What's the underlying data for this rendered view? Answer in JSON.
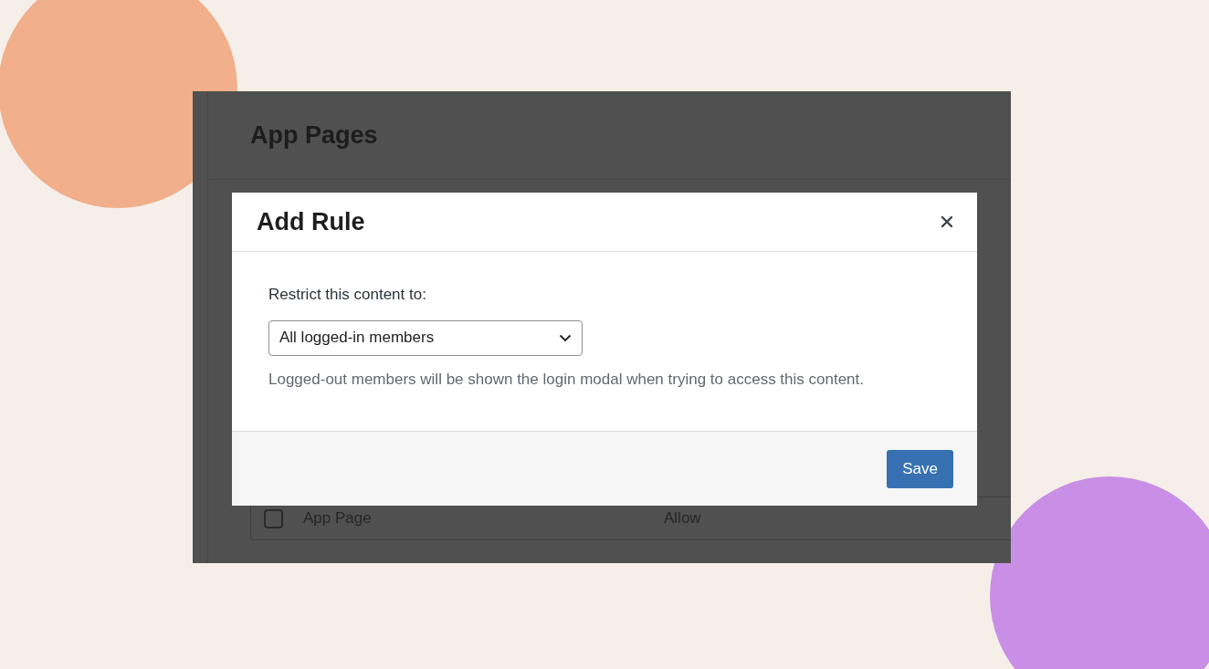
{
  "page": {
    "title": "App Pages",
    "table": {
      "rows": [
        {
          "checked": false,
          "cells": [
            "App Page",
            "Allow"
          ]
        }
      ]
    }
  },
  "modal": {
    "title": "Add Rule",
    "field_label": "Restrict this content to:",
    "select": {
      "value": "All logged-in members"
    },
    "help": "Logged-out members will be shown the login modal when trying to access this content.",
    "buttons": [
      {
        "label": "Save",
        "kind": "primary"
      }
    ]
  }
}
